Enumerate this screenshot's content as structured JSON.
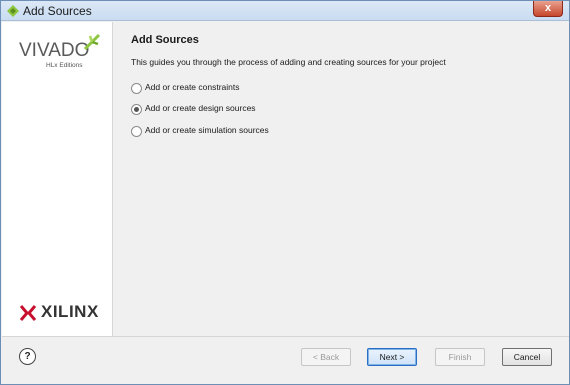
{
  "window": {
    "title": "Add Sources",
    "close_glyph": "x"
  },
  "sidebar": {
    "brand": "VIVADO",
    "edition": "HLx Editions",
    "vendor": "XILINX"
  },
  "main": {
    "heading": "Add Sources",
    "description": "This guides you through the process of adding and creating sources for your project",
    "options": [
      {
        "label": "Add or create constraints",
        "selected": false
      },
      {
        "label": "Add or create design sources",
        "selected": true
      },
      {
        "label": "Add or create simulation sources",
        "selected": false
      }
    ]
  },
  "footer": {
    "help_glyph": "?",
    "back_label": "< Back",
    "next_label": "Next >",
    "finish_label": "Finish",
    "cancel_label": "Cancel"
  },
  "colors": {
    "accent": "#2b6fc2",
    "brand_green": "#8dc63f",
    "xilinx_red": "#c8102e"
  }
}
